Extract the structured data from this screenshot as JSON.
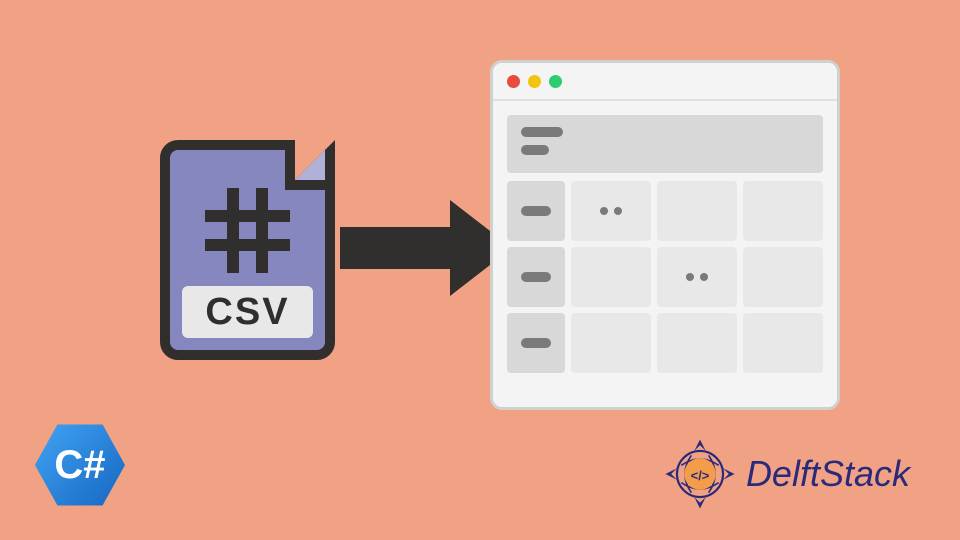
{
  "csv_file": {
    "label": "CSV"
  },
  "csharp": {
    "label": "C#"
  },
  "delftstack": {
    "brand": "DelftStack",
    "code_symbol": "</>"
  },
  "icons": {
    "csv_file": "csv-file-icon",
    "arrow": "arrow-right-icon",
    "grid_window": "datagrid-window-icon",
    "csharp_logo": "csharp-hexagon-logo",
    "delft_emblem": "delftstack-emblem"
  },
  "colors": {
    "background": "#f2a284",
    "csv_fill": "#8787c0",
    "outline": "#312e2e",
    "csharp_blue": "#1e88e5",
    "delft_navy": "#2a2a7a"
  }
}
